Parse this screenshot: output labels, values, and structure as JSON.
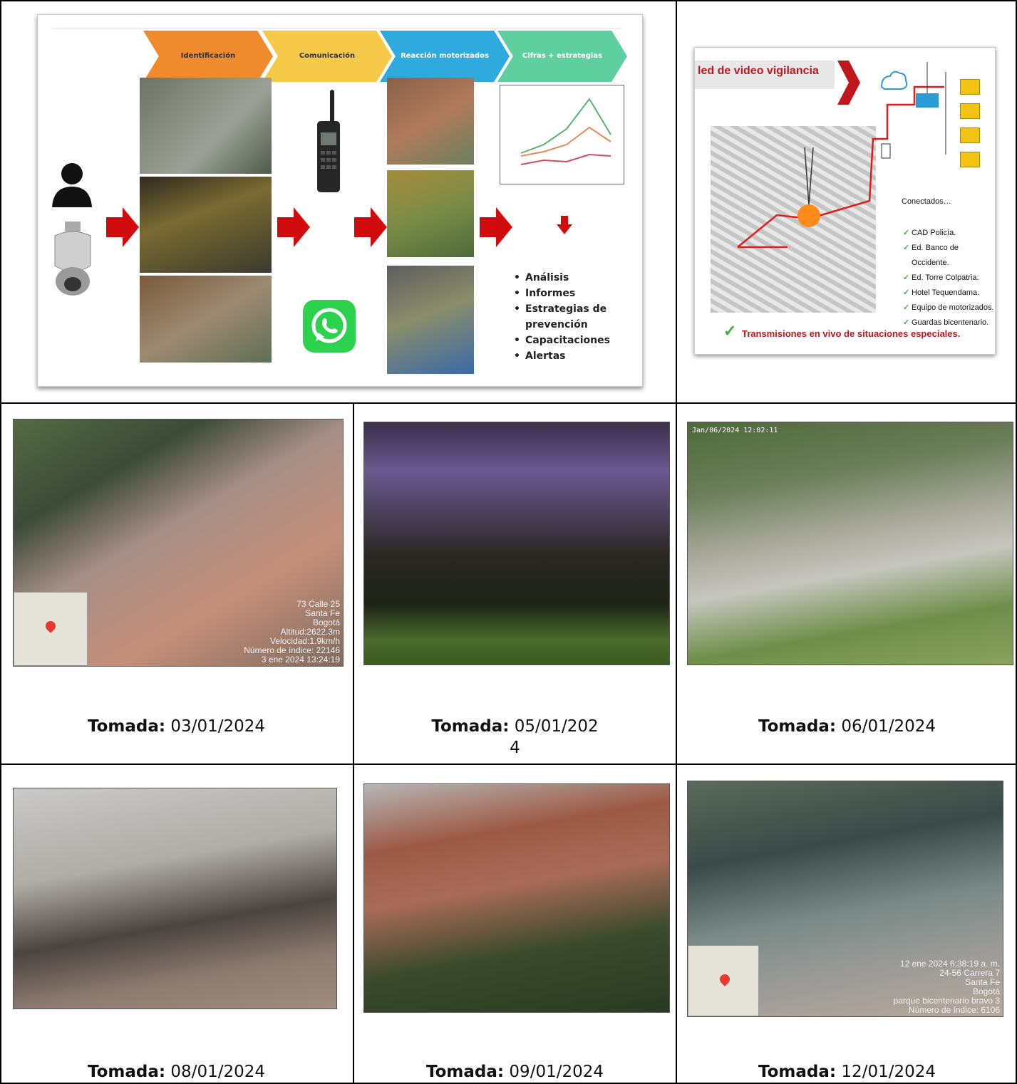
{
  "slide1": {
    "steps": [
      "Identificación",
      "Comunicación",
      "Reacción motorizados",
      "Cifras + estrategias"
    ],
    "bullets": [
      "Análisis",
      "Informes",
      "Estrategias de prevención",
      "Capacitaciones",
      "Alertas"
    ],
    "colors": {
      "step1": "#ef8a2d",
      "step2": "#f6c949",
      "step3": "#2eaadf",
      "step4": "#5ed0a0",
      "arrow": "#d10b0b"
    }
  },
  "slide2": {
    "title": "led de video vigilancia",
    "connected_title": "Conectados…",
    "connected": [
      "CAD Policía.",
      "Ed. Banco de Occidente.",
      "Ed. Torre Colpatria.",
      "Hotel Tequendama.",
      "Equipo de motorizados.",
      "Guardas bicentenario."
    ],
    "footer": "Transmisiones en vivo de situaciones especiales."
  },
  "photos": {
    "p1": {
      "overlay": [
        "73 Calle 25",
        "Santa Fe",
        "Bogotá",
        "Altitud:2622.3m",
        "Velocidad:1.9km/h",
        "Número de índice: 22146",
        "3 ene 2024 13:24:19"
      ]
    },
    "p3": {
      "timestamp": "Jan/06/2024 12:02:11"
    },
    "p6": {
      "overlay": [
        "12 ene 2024 6:38:19 a. m.",
        "24-56 Carrera 7",
        "Santa Fe",
        "Bogotá",
        "parque bicentenario bravo 3",
        "Número de índice: 6106"
      ]
    }
  },
  "captions": {
    "label": "Tomada:",
    "d1": "03/01/2024",
    "d2a": "05/01/202",
    "d2b": "4",
    "d3": "06/01/2024",
    "d4": "08/01/2024",
    "d5": "09/01/2024",
    "d6": "12/01/2024"
  }
}
